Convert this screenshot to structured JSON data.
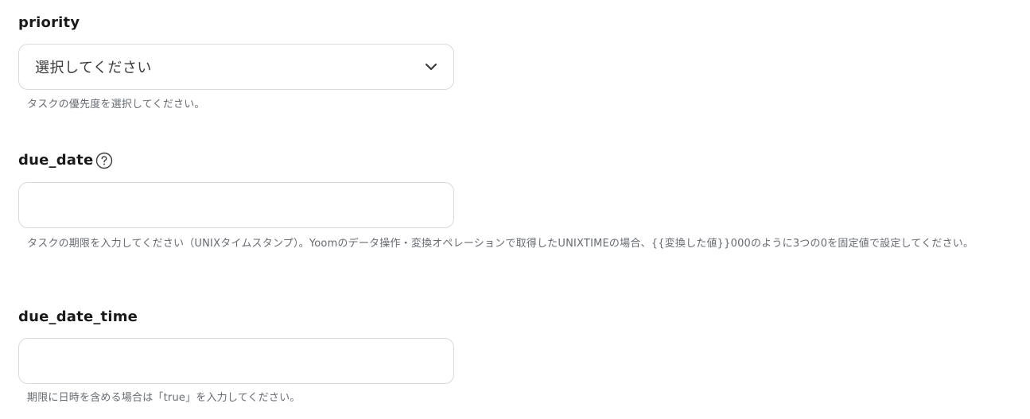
{
  "fields": [
    {
      "label": "priority",
      "type": "select",
      "selected_value": "選択してください",
      "help": "タスクの優先度を選択してください。"
    },
    {
      "label": "due_date",
      "type": "text",
      "value": "",
      "help": "タスクの期限を入力してください（UNIXタイムスタンプ）。Yoomのデータ操作・変換オペレーションで取得したUNIXTIMEの場合、{{変換した値}}000のように3つの0を固定値で設定してください。"
    },
    {
      "label": "due_date_time",
      "type": "text",
      "value": "",
      "help": "期限に日時を含める場合は「true」を入力してください。"
    }
  ],
  "icons": {
    "select_chevron": "chevron-down-icon",
    "due_date_help": "question-circle-icon"
  },
  "colors": {
    "border": "#d6d9de",
    "label": "#1a1a1a",
    "help_text": "#666b72"
  }
}
